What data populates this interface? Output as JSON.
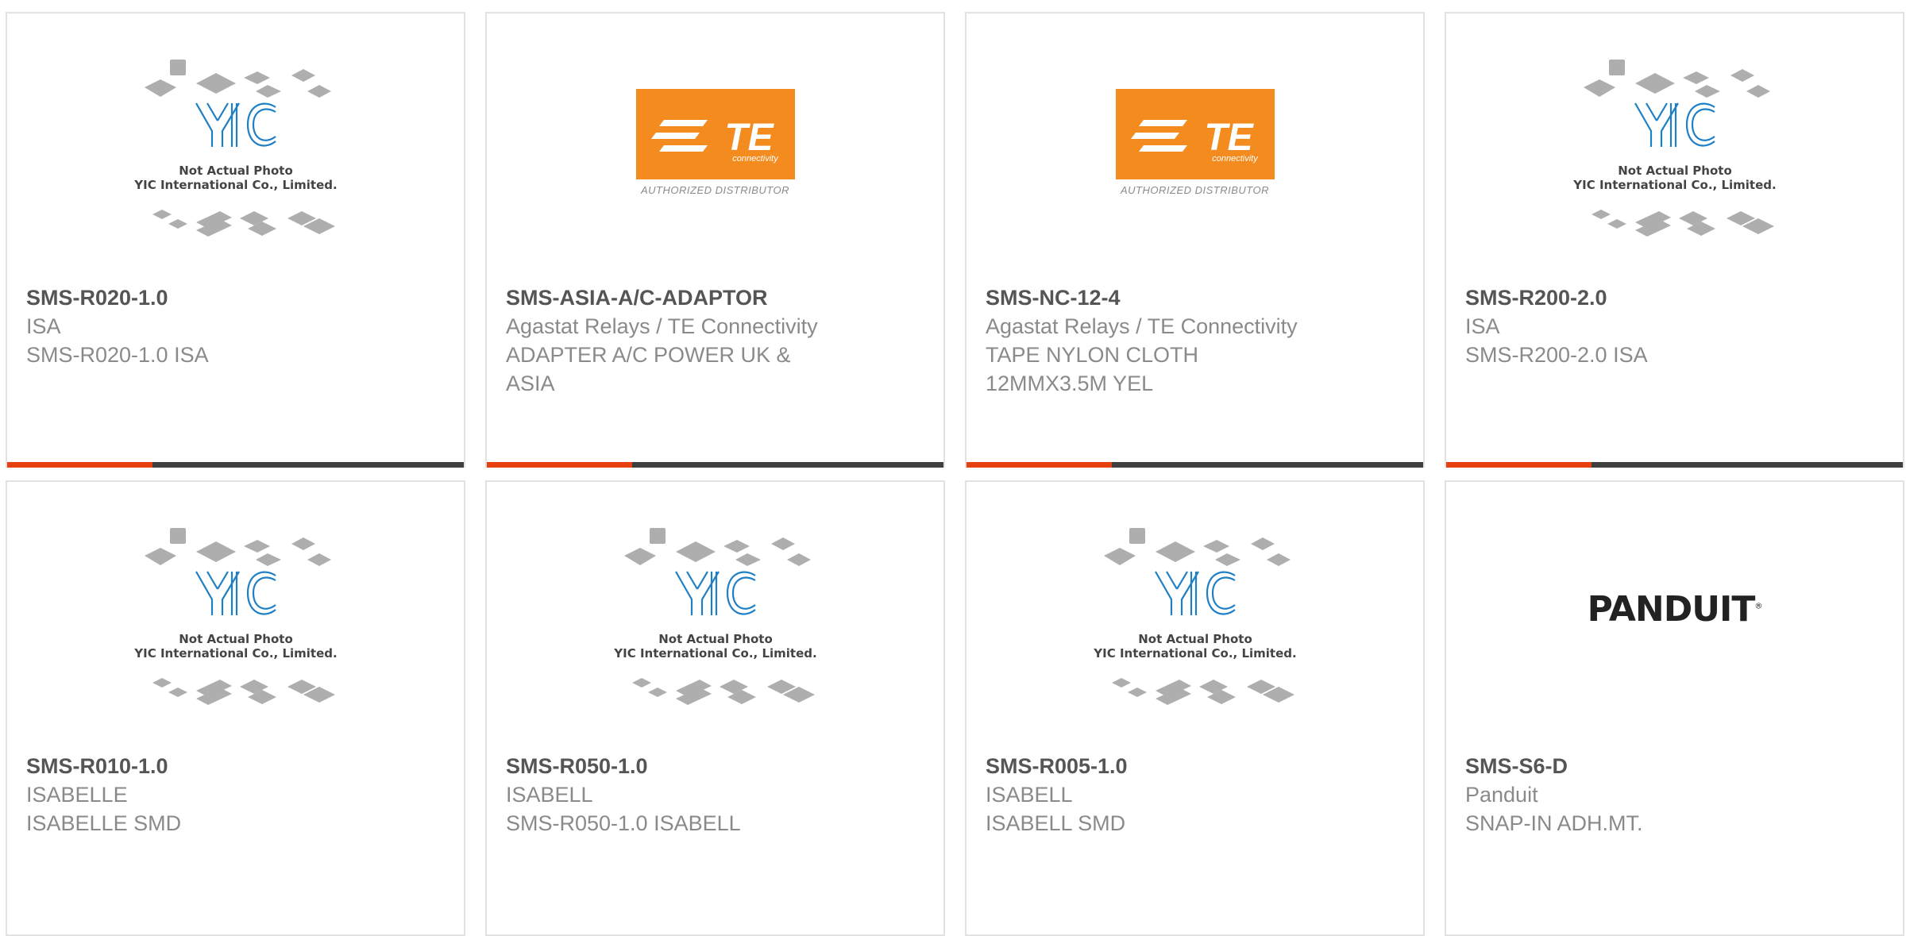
{
  "placeholder_caption": {
    "line1": "Not Actual Photo",
    "line2": "YIC International Co., Limited."
  },
  "te_logo": {
    "wordmark": "TE",
    "sub": "connectivity",
    "caption": "AUTHORIZED DISTRIBUTOR"
  },
  "panduit_logo": {
    "wordmark": "PANDUIT",
    "mark": "®"
  },
  "cards": [
    {
      "image": "yic",
      "part": "SMS-R020-1.0",
      "maker": "ISA",
      "desc": [
        "SMS-R020-1.0 ISA"
      ]
    },
    {
      "image": "te",
      "part": "SMS-ASIA-A/C-ADAPTOR",
      "maker": "Agastat Relays / TE Connectivity",
      "desc": [
        "ADAPTER A/C POWER UK &",
        "ASIA"
      ]
    },
    {
      "image": "te",
      "part": "SMS-NC-12-4",
      "maker": "Agastat Relays / TE Connectivity",
      "desc": [
        "TAPE NYLON CLOTH",
        "12MMX3.5M YEL"
      ]
    },
    {
      "image": "yic",
      "part": "SMS-R200-2.0",
      "maker": "ISA",
      "desc": [
        "SMS-R200-2.0 ISA"
      ]
    },
    {
      "image": "yic",
      "part": "SMS-R010-1.0",
      "maker": "ISABELLE",
      "desc": [
        "ISABELLE SMD"
      ]
    },
    {
      "image": "yic",
      "part": "SMS-R050-1.0",
      "maker": "ISABELL",
      "desc": [
        "SMS-R050-1.0 ISABELL"
      ]
    },
    {
      "image": "yic",
      "part": "SMS-R005-1.0",
      "maker": "ISABELL",
      "desc": [
        "ISABELL SMD"
      ]
    },
    {
      "image": "panduit",
      "part": "SMS-S6-D",
      "maker": "Panduit",
      "desc": [
        "SNAP-IN ADH.MT."
      ]
    }
  ],
  "colors": {
    "accent": "#e63f10",
    "bar": "#3f3f3f",
    "te_orange": "#f48b1f",
    "yic_blue": "#1f7fc4"
  }
}
